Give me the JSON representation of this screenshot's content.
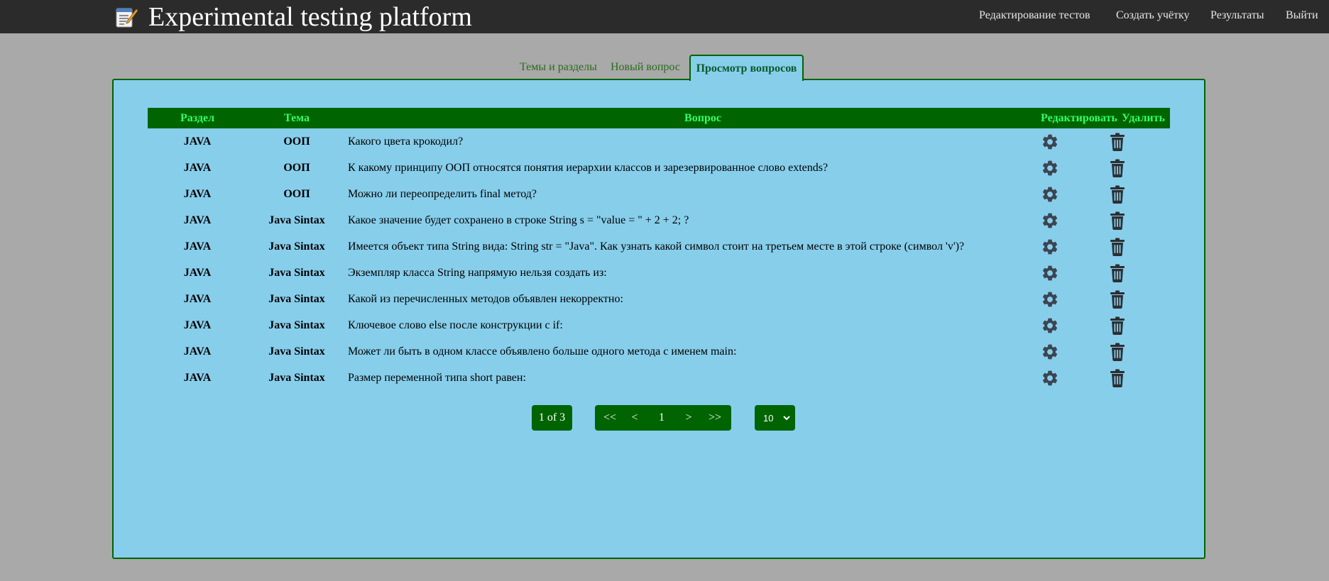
{
  "app": {
    "title": "Experimental testing platform"
  },
  "nav": {
    "items": [
      {
        "label": "Редактирование тестов"
      },
      {
        "label": "Создать учётку"
      },
      {
        "label": "Результаты"
      },
      {
        "label": "Выйти"
      }
    ]
  },
  "tabs": [
    {
      "label": "Темы и разделы",
      "active": false
    },
    {
      "label": "Новый вопрос",
      "active": false
    },
    {
      "label": "Просмотр вопросов",
      "active": true
    }
  ],
  "table": {
    "headers": {
      "section": "Раздел",
      "topic": "Тема",
      "question": "Вопрос",
      "edit": "Редактировать",
      "delete": "Удалить"
    },
    "rows": [
      {
        "section": "JAVA",
        "topic": "ООП",
        "question": "Какого цвета крокодил?"
      },
      {
        "section": "JAVA",
        "topic": "ООП",
        "question": "К какому принципу ООП относятся понятия иерархии классов и зарезервированное слово extends?"
      },
      {
        "section": "JAVA",
        "topic": "ООП",
        "question": "Можно ли переопределить final метод?"
      },
      {
        "section": "JAVA",
        "topic": "Java Sintax",
        "question": "Какое значение будет сохранено в строке String s = \"value = \" + 2 + 2; ?"
      },
      {
        "section": "JAVA",
        "topic": "Java Sintax",
        "question": "Имеется объект типа String вида: String str = \"Java\". Как узнать какой символ стоит на третьем месте в этой строке (символ 'v')?"
      },
      {
        "section": "JAVA",
        "topic": "Java Sintax",
        "question": "Экземпляр класса String напрямую нельзя создать из:"
      },
      {
        "section": "JAVA",
        "topic": "Java Sintax",
        "question": "Какой из перечисленных методов объявлен некорректно:"
      },
      {
        "section": "JAVA",
        "topic": "Java Sintax",
        "question": "Ключевое слово else после конструкции с if:"
      },
      {
        "section": "JAVA",
        "topic": "Java Sintax",
        "question": "Может ли быть в одном классе объявлено больше одного метода с именем main:"
      },
      {
        "section": "JAVA",
        "topic": "Java Sintax",
        "question": "Размер переменной типа short равен:"
      }
    ]
  },
  "pagination": {
    "info": "1 of 3",
    "first": "<<",
    "prev": "<",
    "current": "1",
    "next": ">",
    "last": ">>",
    "page_size": "10"
  },
  "colors": {
    "navbar": "#2b2b2b",
    "page_bg": "#a9a9a9",
    "panel_bg": "#87ceeb",
    "accent_green": "#006400",
    "header_text": "#33ff66"
  },
  "icons": {
    "edit": "gear-icon",
    "delete": "trash-icon",
    "brand": "notepad-pencil-icon"
  }
}
